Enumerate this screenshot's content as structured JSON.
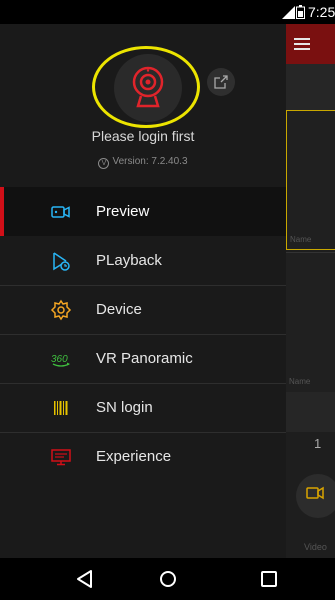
{
  "status_bar": {
    "time": "7:25"
  },
  "drawer": {
    "login_text": "Please login first",
    "version": "Version: 7.2.40.3",
    "menu": [
      {
        "label": "Preview",
        "icon": "camera-icon",
        "color": "#29b6f6",
        "active": true
      },
      {
        "label": "PLayback",
        "icon": "playback-icon",
        "color": "#29b6f6",
        "active": false
      },
      {
        "label": "Device",
        "icon": "gear-icon",
        "color": "#f5a623",
        "active": false
      },
      {
        "label": "VR Panoramic",
        "icon": "panorama-360-icon",
        "color": "#3fbf3f",
        "active": false
      },
      {
        "label": "SN login",
        "icon": "barcode-icon",
        "color": "#e6c200",
        "active": false
      },
      {
        "label": "Experience",
        "icon": "monitor-icon",
        "color": "#d10f18",
        "active": false
      }
    ]
  },
  "background_app": {
    "channel_number": "1",
    "video_label": "Video",
    "cell_name_1": "Name",
    "cell_name_2": "Name"
  },
  "colors": {
    "accent": "#d10f18",
    "highlight_ring": "#ece400",
    "drawer_bg": "#1a1a1a"
  }
}
